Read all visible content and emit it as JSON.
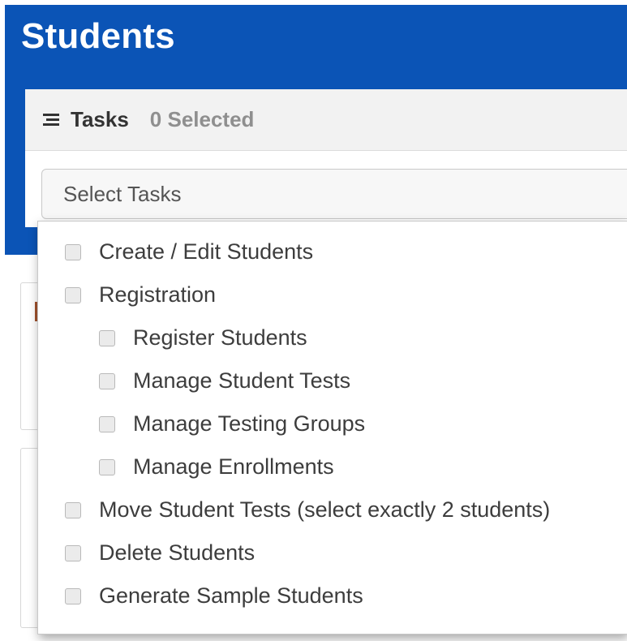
{
  "page": {
    "title": "Students"
  },
  "tasks": {
    "label": "Tasks",
    "selected_count": "0 Selected",
    "select_placeholder": "Select Tasks"
  },
  "options": [
    {
      "label": "Create / Edit Students",
      "checked": false
    },
    {
      "label": "Registration",
      "checked": false
    },
    {
      "label": "Register Students",
      "checked": false
    },
    {
      "label": "Manage Student Tests",
      "checked": false
    },
    {
      "label": "Manage Testing Groups",
      "checked": false
    },
    {
      "label": "Manage Enrollments",
      "checked": false
    },
    {
      "label": "Move Student Tests (select exactly 2 students)",
      "checked": false
    },
    {
      "label": "Delete Students",
      "checked": false
    },
    {
      "label": "Generate Sample Students",
      "checked": false
    }
  ],
  "colors": {
    "header": "#0b54b6",
    "title": "#ffffff"
  }
}
